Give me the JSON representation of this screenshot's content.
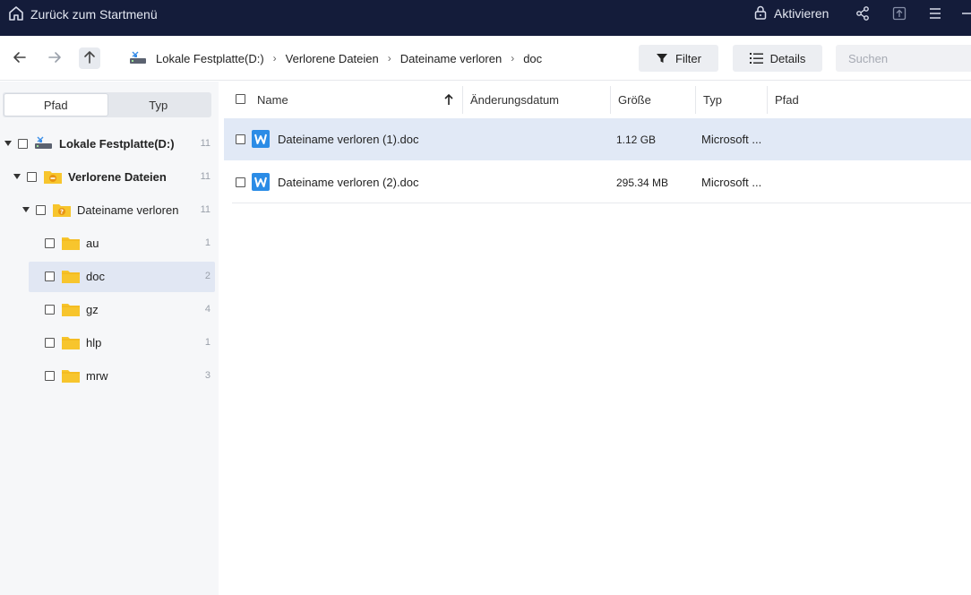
{
  "titlebar": {
    "home_label": "Zurück zum Startmenü",
    "activate_label": "Aktivieren",
    "icons": [
      "home-icon",
      "lock-icon",
      "share-icon",
      "upload-icon",
      "menu-icon",
      "minimize-icon"
    ]
  },
  "toolbar": {
    "breadcrumbs": [
      "Lokale Festplatte(D:)",
      "Verlorene Dateien",
      "Dateiname verloren",
      "doc"
    ],
    "filter_label": "Filter",
    "details_label": "Details",
    "search_placeholder": "Suchen"
  },
  "sidebar": {
    "tabs": [
      {
        "label": "Pfad",
        "active": true
      },
      {
        "label": "Typ",
        "active": false
      }
    ],
    "tree": [
      {
        "label": "Lokale Festplatte(D:)",
        "count": "11",
        "icon": "drive-icon",
        "expanded": true
      },
      {
        "label": "Verlorene Dateien",
        "count": "11",
        "icon": "lost-folder-icon",
        "expanded": true
      },
      {
        "label": "Dateiname verloren",
        "count": "11",
        "icon": "unknown-folder-icon",
        "expanded": true
      },
      {
        "label": "au",
        "count": "1",
        "icon": "folder-icon"
      },
      {
        "label": "doc",
        "count": "2",
        "icon": "folder-icon",
        "selected": true
      },
      {
        "label": "gz",
        "count": "4",
        "icon": "folder-icon"
      },
      {
        "label": "hlp",
        "count": "1",
        "icon": "folder-icon"
      },
      {
        "label": "mrw",
        "count": "3",
        "icon": "folder-icon"
      }
    ]
  },
  "list": {
    "columns": [
      "Name",
      "Änderungsdatum",
      "Größe",
      "Typ",
      "Pfad"
    ],
    "sort": "ascending",
    "rows": [
      {
        "name": "Dateiname verloren (1).doc",
        "date": "",
        "size": "1.12 GB",
        "type": "Microsoft ...",
        "path": "",
        "selected": true
      },
      {
        "name": "Dateiname verloren (2).doc",
        "date": "",
        "size": "295.34 MB",
        "type": "Microsoft ...",
        "path": "",
        "selected": false
      }
    ]
  },
  "colors": {
    "titlebar_bg": "#141c3a",
    "selection_bg": "#e1e9f6",
    "folder_yellow": "#f7c52d",
    "word_blue": "#2b8ce6"
  }
}
